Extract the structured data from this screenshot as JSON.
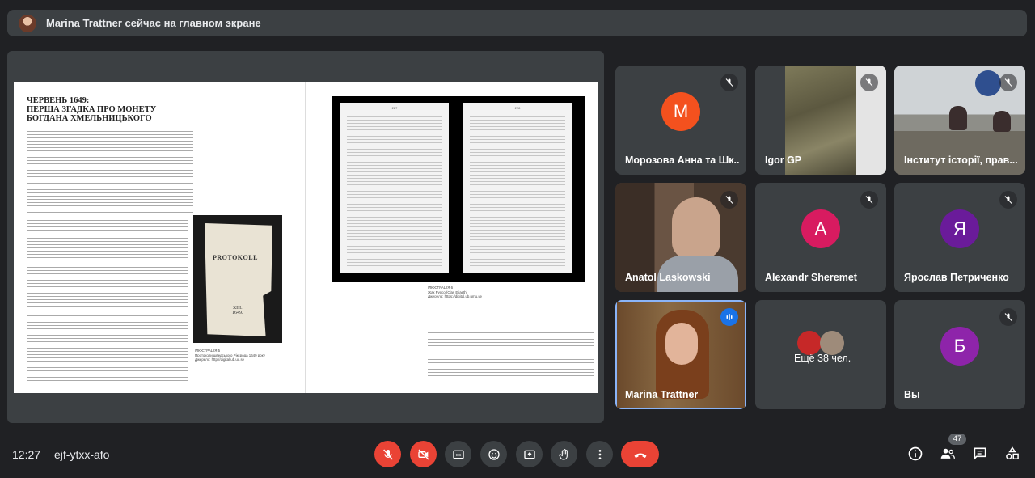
{
  "banner": {
    "text": "Marina Trattner сейчас на главном экране"
  },
  "document": {
    "title": "ЧЕРВЕНЬ 1649:\nПЕРША ЗГАДКА ПРО МОНЕТУ\nБОГДАНА ХМЕЛЬНИЦЬКОГО",
    "book_title": "PROTOKOLL",
    "book_year": "XIII.\n1649.",
    "left_caption": "ІЛЮСТРАЦІЯ 5\nПротоколи шведського Ріксрода 1649 року\nДжерело: http://digital.ub.uu.se",
    "right_caption": "ІЛЮСТРАЦІЯ 6\nЖак Руссо (Clas Eliaeth)\nДжерело: https://digital.ub.umu.se",
    "scan_left_num": "227",
    "scan_right_num": "228"
  },
  "participants": [
    {
      "name": "Морозова Анна та Шк...",
      "initial": "М",
      "color": "#f4511e",
      "type": "avatar"
    },
    {
      "name": "Igor GP",
      "type": "video"
    },
    {
      "name": "Інститут історії, прав...",
      "type": "video"
    },
    {
      "name": "Anatol Laskowski",
      "type": "video"
    },
    {
      "name": "Alexandr Sheremet",
      "initial": "A",
      "color": "#d81b60",
      "type": "avatar"
    },
    {
      "name": "Ярослав Петриченко",
      "initial": "Я",
      "color": "#6a1b9a",
      "type": "avatar"
    },
    {
      "name": "Marina Trattner",
      "type": "video"
    },
    {
      "name": "Ещё 38 чел.",
      "type": "group"
    },
    {
      "name": "Вы",
      "initial": "Б",
      "color": "#8e24aa",
      "type": "avatar"
    }
  ],
  "bottom": {
    "time": "12:27",
    "meeting_code": "ejf-ytxx-afo",
    "participant_count": "47"
  }
}
